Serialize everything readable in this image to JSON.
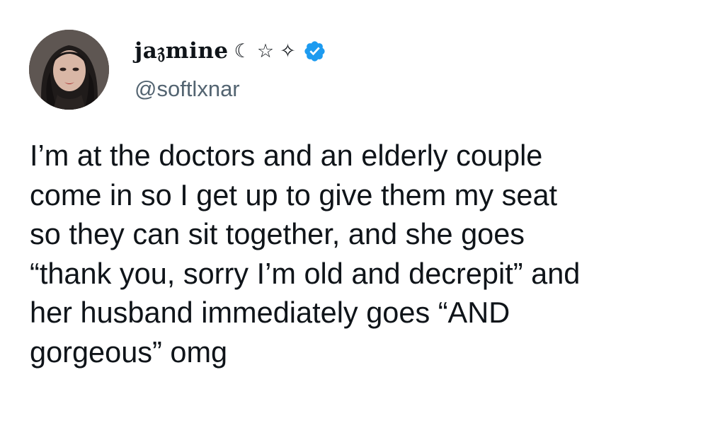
{
  "author": {
    "display_name": "ja𝔷mine",
    "name_symbols": [
      "☾",
      "☆",
      "✧"
    ],
    "handle": "@softlxnar",
    "verified": true,
    "avatar_icon": "profile-photo",
    "verified_icon": "verified-badge-icon"
  },
  "tweet": {
    "lines": [
      "I’m at the doctors and an elderly couple",
      "come in so I get up to give them my seat",
      "so they can sit together, and she goes",
      "“thank you, sorry I’m old and decrepit” and",
      "her husband immediately goes “AND",
      "gorgeous” omg"
    ]
  },
  "colors": {
    "text": "#0f1419",
    "secondary": "#536471",
    "verified": "#1d9bf0",
    "background": "#ffffff"
  }
}
